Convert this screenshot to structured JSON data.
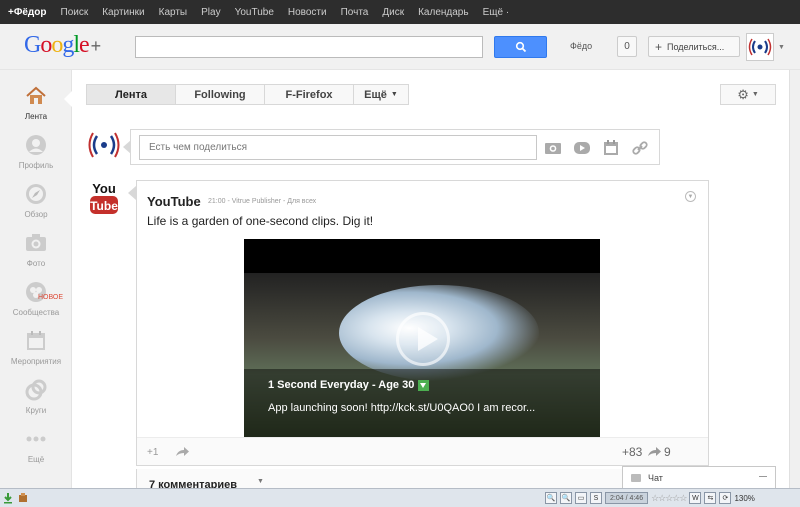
{
  "gbar": {
    "items": [
      "+Фёдор",
      "Поиск",
      "Картинки",
      "Карты",
      "Play",
      "YouTube",
      "Новости",
      "Почта",
      "Диск",
      "Календарь",
      "Ещё ·"
    ]
  },
  "header": {
    "logo": "Google+",
    "search_placeholder": "",
    "username": "Фёдо",
    "notifications": "0",
    "share_label": "Поделиться..."
  },
  "sidebar": {
    "items": [
      {
        "label": "Лента",
        "icon": "home-icon"
      },
      {
        "label": "Профиль",
        "icon": "profile-icon"
      },
      {
        "label": "Обзор",
        "icon": "explore-icon"
      },
      {
        "label": "Фото",
        "icon": "camera-icon"
      },
      {
        "label": "Сообщества",
        "icon": "communities-icon",
        "badge": "НОВОЕ"
      },
      {
        "label": "Мероприятия",
        "icon": "events-icon"
      },
      {
        "label": "Круги",
        "icon": "circles-icon"
      },
      {
        "label": "Ещё",
        "icon": "more-icon"
      }
    ]
  },
  "tabs": [
    "Лента",
    "Following",
    "F-Firefox",
    "Ещё"
  ],
  "sharebox": {
    "placeholder": "Есть чем поделиться"
  },
  "post": {
    "author": "YouTube",
    "meta": "21:00  -  Vitrue Publisher  -  Для всех",
    "text": "Life is a garden of one-second clips. Dig it!",
    "video_title": "1 Second Everyday - Age 30",
    "video_desc": "App launching soon! http://kck.st/U0QAO0 I am recor...",
    "plus_one": "+1",
    "plus_count": "+83",
    "share_count": "9",
    "comments": "7 комментариев"
  },
  "chat": {
    "label": "Чат"
  },
  "statusbar": {
    "time": "2:04 / 4:46",
    "zoom": "130%"
  },
  "colors": {
    "search_button": "#4d90fe",
    "topbar": "#2d2d2d",
    "badge_new": "#dd4b39"
  }
}
